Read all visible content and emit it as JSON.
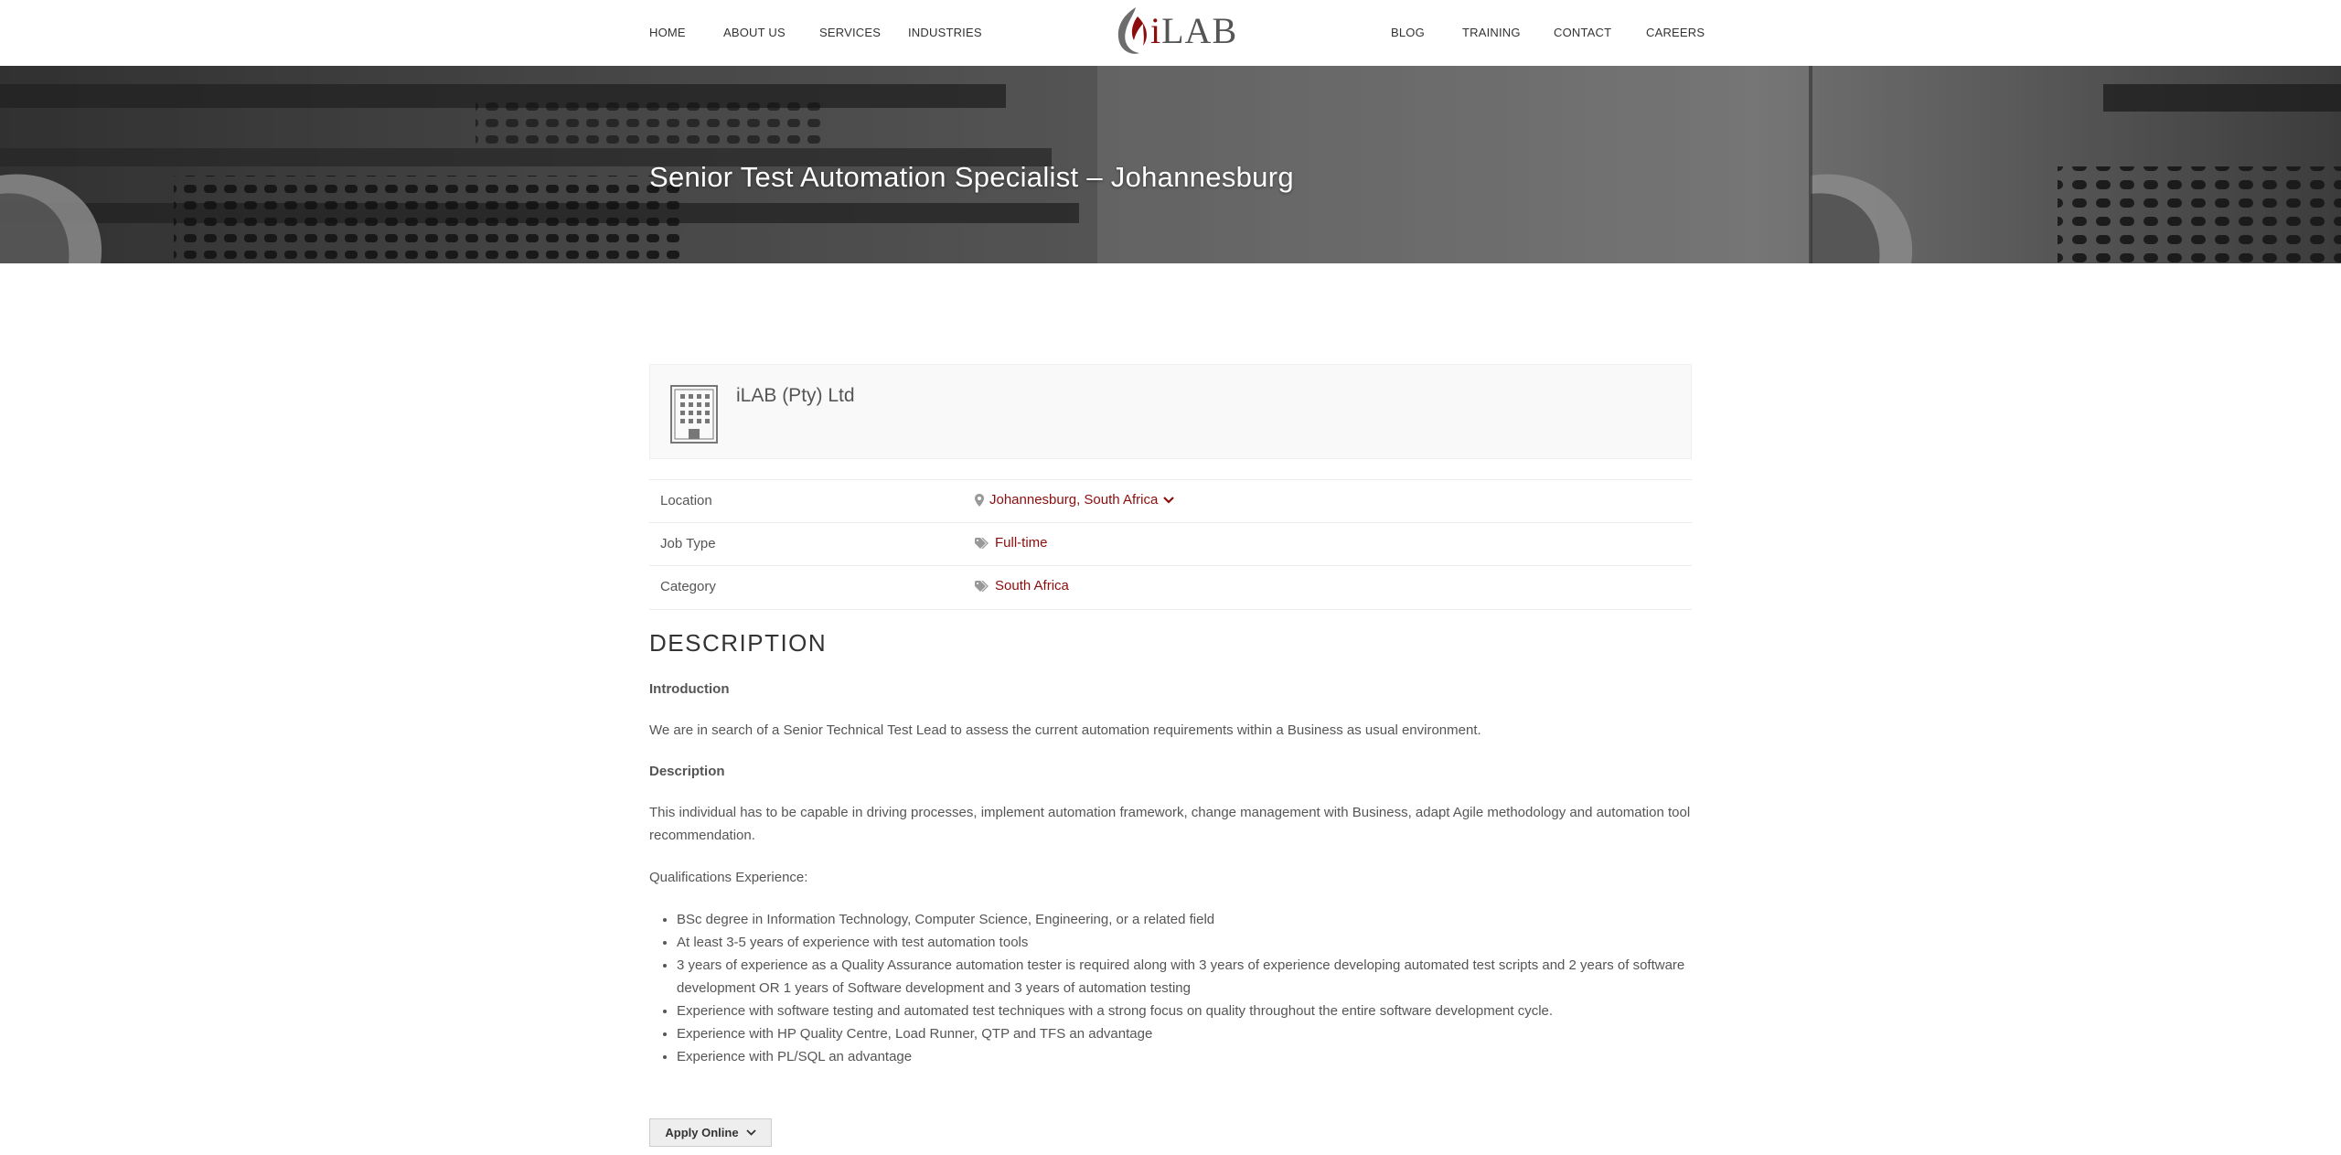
{
  "nav": {
    "left": [
      "HOME",
      "ABOUT US",
      "SERVICES",
      "INDUSTRIES"
    ],
    "right": [
      "BLOG",
      "TRAINING",
      "CONTACT",
      "CAREERS"
    ],
    "logo_text_i": "i",
    "logo_text_rest": "LAB"
  },
  "hero": {
    "title": "Senior Test Automation Specialist – Johannesburg"
  },
  "company": {
    "name": "iLAB (Pty) Ltd",
    "icon": "building-icon"
  },
  "meta": {
    "location": {
      "label": "Location",
      "value": "Johannesburg, South Africa",
      "icon": "map-pin-icon"
    },
    "job_type": {
      "label": "Job Type",
      "value": "Full-time",
      "icon": "tag-icon"
    },
    "category": {
      "label": "Category",
      "value": "South Africa",
      "icon": "tag-icon"
    }
  },
  "description": {
    "heading": "DESCRIPTION",
    "intro_heading": "Introduction",
    "intro_text": "We are in search of a Senior Technical Test Lead to assess the current automation requirements within a Business as usual environment.",
    "desc_heading": "Description",
    "desc_text": "This individual has to be capable in driving processes, implement automation framework, change management with Business, adapt Agile methodology and automation tool recommendation.",
    "qual_heading": "Qualifications Experience:",
    "qualifications": [
      "BSc degree in Information Technology, Computer Science, Engineering, or a related field",
      "At least 3-5 years of experience with test automation tools",
      "3 years of experience as a Quality Assurance automation tester is required along with 3 years of experience developing automated test scripts and 2 years of software development OR 1 years of Software development and 3 years of automation testing",
      "Experience with software testing and automated test techniques with a strong focus on quality throughout the entire software development cycle.",
      "Experience with HP Quality Centre, Load Runner, QTP and TFS an advantage",
      "Experience with PL/SQL an advantage"
    ]
  },
  "apply": {
    "label": "Apply Online",
    "icon": "chevron-down-icon"
  },
  "colors": {
    "accent": "#8b0d0d",
    "text": "#555555",
    "heading": "#333333"
  }
}
